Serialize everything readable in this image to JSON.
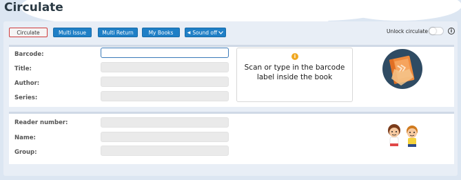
{
  "page": {
    "title": "Circulate"
  },
  "toolbar": {
    "circulate": "Circulate",
    "multi_issue": "Multi Issue",
    "multi_return": "Multi Return",
    "my_books": "My Books",
    "sound": "Sound off",
    "unlock_label": "Unlock circulate",
    "unlock_enabled": false
  },
  "book": {
    "barcode_label": "Barcode:",
    "title_label": "Title:",
    "author_label": "Author:",
    "series_label": "Series:",
    "barcode_value": "",
    "title_value": "",
    "author_value": "",
    "series_value": "",
    "hint": "Scan or type in the barcode label inside the book"
  },
  "reader": {
    "number_label": "Reader number:",
    "name_label": "Name:",
    "group_label": "Group:",
    "number_value": "",
    "name_value": "",
    "group_value": ""
  },
  "colors": {
    "primary_button": "#1f7fc6",
    "active_outline": "#cf3a3a",
    "info_badge": "#f0a822",
    "book_circle": "#2f4b63",
    "book_cover": "#f08a3c"
  },
  "icons": {
    "info": "info-icon",
    "hint": "warning-icon",
    "book": "book-illustration",
    "readers": "children-illustration",
    "sound": "speaker-icon",
    "dropdown": "chevron-down-icon"
  }
}
